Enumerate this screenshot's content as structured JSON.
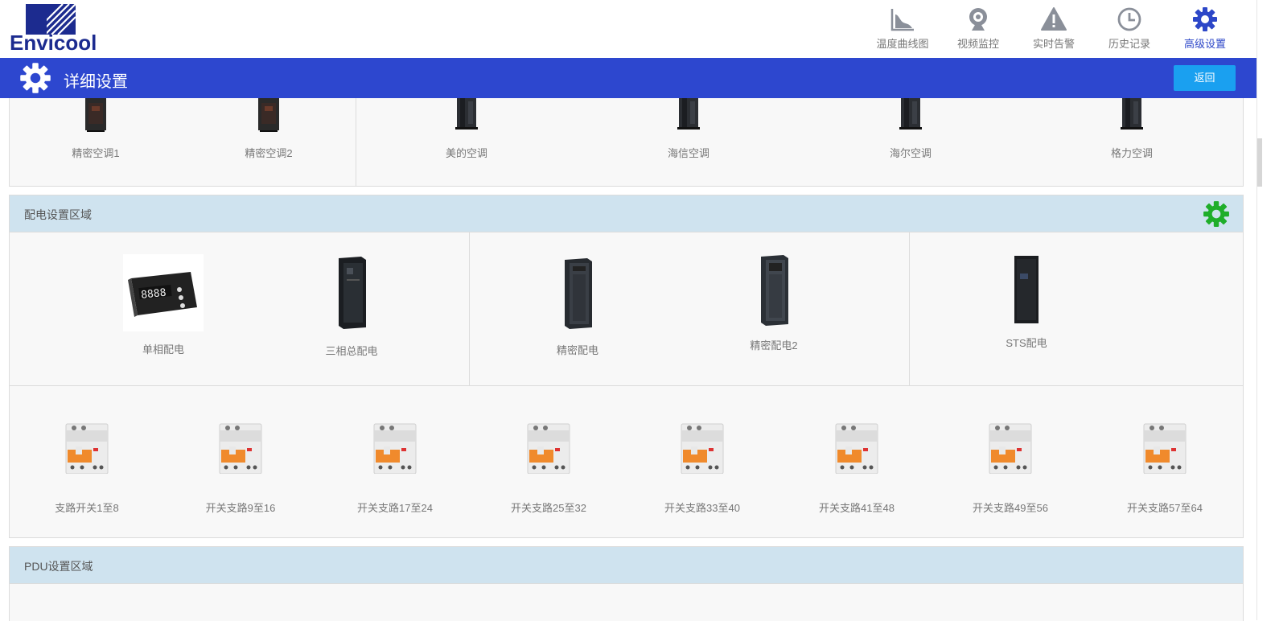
{
  "brand": {
    "logo_text": "Envicool"
  },
  "nav": [
    {
      "label": "温度曲线图",
      "icon": "area-chart-icon"
    },
    {
      "label": "视频监控",
      "icon": "camera-icon"
    },
    {
      "label": "实时告警",
      "icon": "warning-icon"
    },
    {
      "label": "历史记录",
      "icon": "clock-icon"
    },
    {
      "label": "高级设置",
      "icon": "gear-icon",
      "active": true
    }
  ],
  "page": {
    "title": "详细设置",
    "back_label": "返回"
  },
  "ac_section": {
    "items": [
      "精密空调1",
      "精密空调2",
      "美的空调",
      "海信空调",
      "海尔空调",
      "格力空调"
    ]
  },
  "power_section": {
    "title": "配电设置区域",
    "devices": [
      "单相配电",
      "三相总配电",
      "精密配电",
      "精密配电2",
      "STS配电"
    ],
    "switches": [
      "支路开关1至8",
      "开关支路9至16",
      "开关支路17至24",
      "开关支路25至32",
      "开关支路33至40",
      "开关支路41至48",
      "开关支路49至56",
      "开关支路57至64"
    ]
  },
  "pdu_section": {
    "title": "PDU设置区域"
  },
  "colors": {
    "accent": "#2d47cf",
    "back_button": "#1aa0f0",
    "section_header": "#cfe3ef",
    "section_gear": "#1fae2a"
  }
}
